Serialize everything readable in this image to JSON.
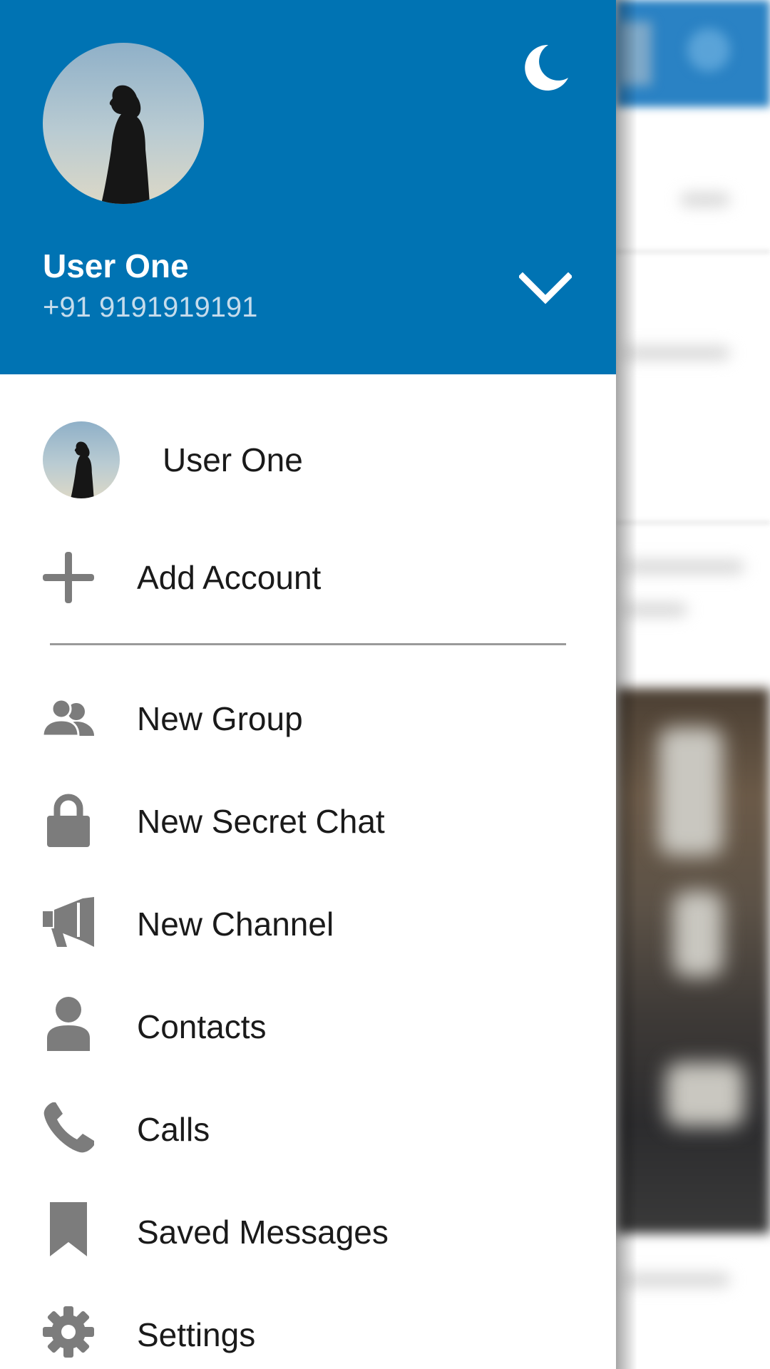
{
  "header": {
    "user_name": "User One",
    "phone": "+91 9191919191",
    "theme_icon": "moon-icon",
    "expand_icon": "chevron-down-icon",
    "background_color": "#0073b3"
  },
  "accounts": {
    "items": [
      {
        "label": "User One",
        "icon": "avatar"
      }
    ],
    "add_account_label": "Add Account",
    "add_account_icon": "plus-icon"
  },
  "menu": {
    "items": [
      {
        "label": "New Group",
        "icon": "group-icon"
      },
      {
        "label": "New Secret Chat",
        "icon": "lock-icon"
      },
      {
        "label": "New Channel",
        "icon": "megaphone-icon"
      },
      {
        "label": "Contacts",
        "icon": "person-icon"
      },
      {
        "label": "Calls",
        "icon": "phone-icon"
      },
      {
        "label": "Saved Messages",
        "icon": "bookmark-icon"
      },
      {
        "label": "Settings",
        "icon": "gear-icon"
      }
    ],
    "icon_color": "#7c7c7c"
  }
}
